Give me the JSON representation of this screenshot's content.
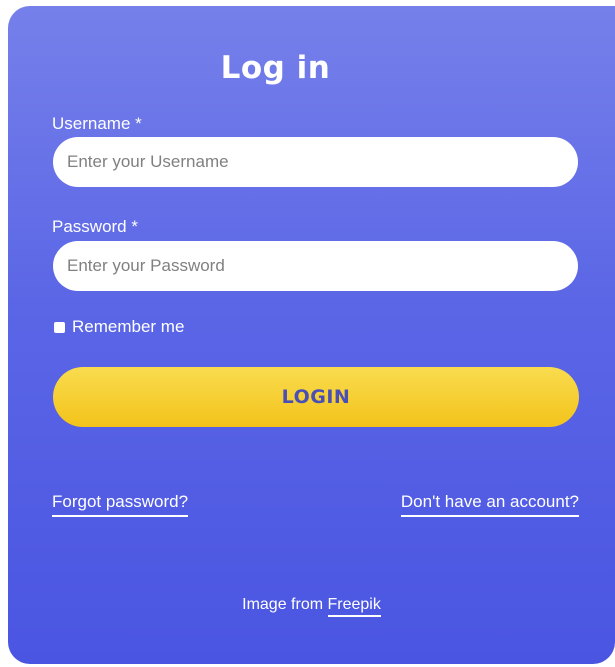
{
  "form": {
    "title": "Log in",
    "username_label": "Username *",
    "username_placeholder": "Enter your Username",
    "username_value": "",
    "password_label": "Password *",
    "password_placeholder": "Enter your Password",
    "password_value": "",
    "remember_label": "Remember me",
    "remember_checked": false,
    "login_label": "LOGIN",
    "forgot_label": "Forgot password?",
    "signup_label": "Don't have an account?"
  },
  "footer": {
    "credit_prefix": "Image from",
    "credit_link": "Freepik"
  },
  "colors": {
    "card_top": "#7680ea",
    "card_bottom": "#4a55e2",
    "button_top": "#f9dc4f",
    "button_bottom": "#f3c31a",
    "button_text": "#4a4fb5"
  }
}
